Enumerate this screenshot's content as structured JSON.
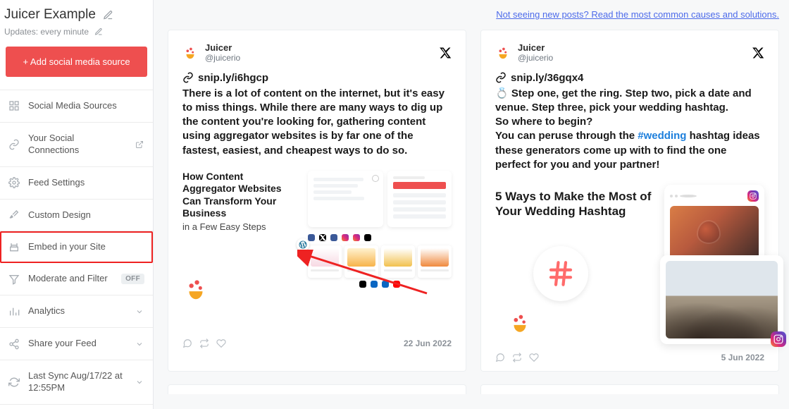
{
  "sidebar": {
    "title": "Juicer Example",
    "subtitle": "Updates: every minute",
    "add_button_label": "+ Add social media source",
    "items": [
      {
        "label": "Social Media Sources",
        "icon": "grid-icon",
        "tail": "none"
      },
      {
        "label": "Your Social Connections",
        "icon": "link-icon",
        "tail": "external"
      },
      {
        "label": "Feed Settings",
        "icon": "gear-icon",
        "tail": "none"
      },
      {
        "label": "Custom Design",
        "icon": "brush-icon",
        "tail": "none"
      },
      {
        "label": "Embed in your Site",
        "icon": "embed-icon",
        "tail": "none",
        "highlighted": true
      },
      {
        "label": "Moderate and Filter",
        "icon": "filter-icon",
        "tail": "badge",
        "badge": "OFF"
      },
      {
        "label": "Analytics",
        "icon": "analytics-icon",
        "tail": "chevron"
      },
      {
        "label": "Share your Feed",
        "icon": "share-icon",
        "tail": "chevron"
      },
      {
        "label": "Last Sync Aug/17/22 at 12:55PM",
        "icon": "sync-icon",
        "tail": "chevron"
      }
    ]
  },
  "top_link": "Not seeing new posts? Read the most common causes and solutions.",
  "posts": [
    {
      "author": "Juicer",
      "handle": "@juicerio",
      "snip_label": "snip.ly/i6hgcp",
      "body": "There is a lot of content on the internet, but it's easy to miss things. While there are many ways to dig up the content you're looking for, gathering content using aggregator websites is by far one of the fastest, easiest, and cheapest ways to do so.",
      "image_headline": "How Content Aggregator Websites Can Transform Your Business",
      "image_sub": "in a Few Easy Steps",
      "date": "22 Jun 2022"
    },
    {
      "author": "Juicer",
      "handle": "@juicerio",
      "snip_label": "snip.ly/36gqx4",
      "body_pre": "💍 Step one, get the ring. Step two, pick a date and venue. Step three, pick your wedding hashtag.\nSo where to begin?\nYou can peruse through the ",
      "body_hashtag": "#wedding",
      "body_post": " hashtag ideas these generators come up with to find the one perfect for you and your partner!",
      "image_headline": "5 Ways to Make the Most of Your Wedding Hashtag",
      "date": "5 Jun 2022"
    }
  ]
}
